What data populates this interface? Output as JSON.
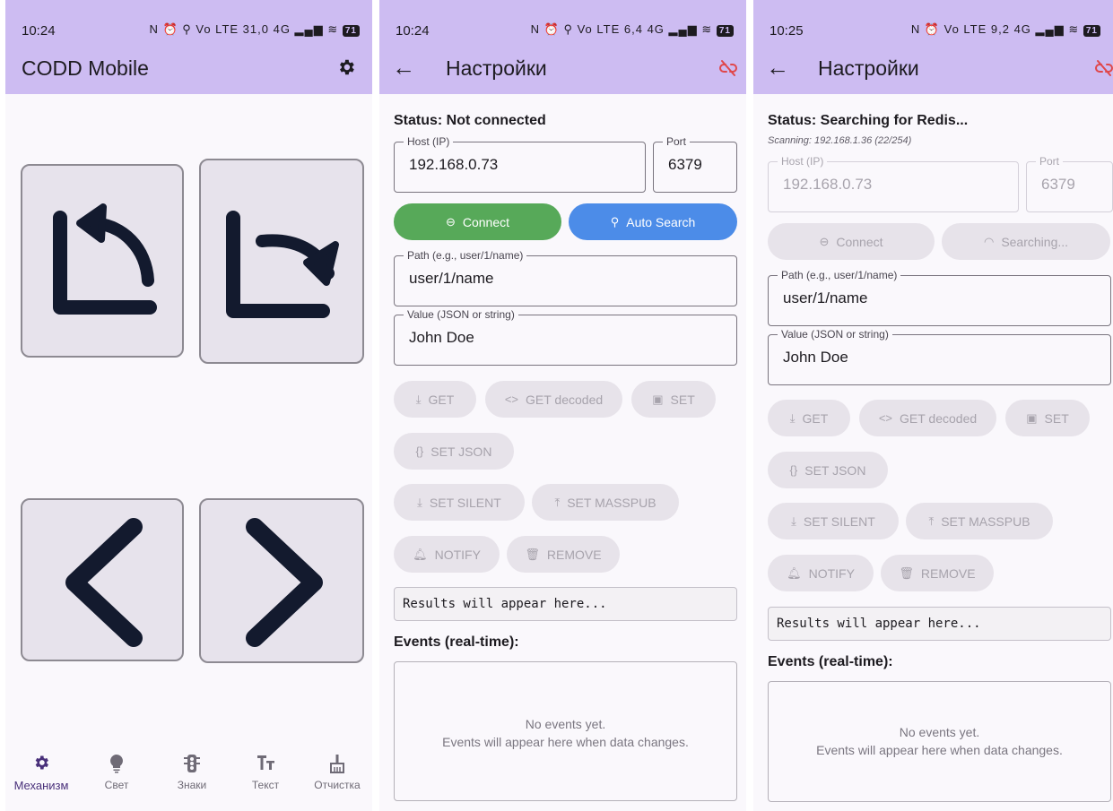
{
  "colors": {
    "appbar": "#cdbcf2",
    "connect_green": "#57a959",
    "search_blue": "#4c8ce8",
    "disconnected_red": "#e0474a",
    "button_icon_navy": "#131a2e"
  },
  "screen1": {
    "status_time": "10:24",
    "status_icons": "N ⏰ ⚲ Vo LTE 31,0 4G ▂▄▆ ≋",
    "battery": "71",
    "title": "CODD Mobile",
    "settings_icon": "gear-icon",
    "buttons": [
      "rotate-left-icon",
      "rotate-right-icon",
      "chevron-left-icon",
      "chevron-right-icon"
    ],
    "nav": [
      {
        "label": "Механизм",
        "icon": "gear-icon"
      },
      {
        "label": "Свет",
        "icon": "lightbulb-icon"
      },
      {
        "label": "Знаки",
        "icon": "traffic-light-icon"
      },
      {
        "label": "Текст",
        "icon": "text-size-icon"
      },
      {
        "label": "Отчистка",
        "icon": "broom-icon"
      }
    ]
  },
  "screen2": {
    "status_time": "10:24",
    "status_icons": "N ⏰ ⚲ Vo LTE 6,4 4G ▂▄▆ ≋",
    "battery": "71",
    "title": "Настройки",
    "status": "Status: Not connected",
    "host_label": "Host (IP)",
    "host_value": "192.168.0.73",
    "port_label": "Port",
    "port_value": "6379",
    "connect_label": "Connect",
    "search_label": "Auto Search",
    "path_label": "Path (e.g., user/1/name)",
    "path_value": "user/1/name",
    "value_label": "Value (JSON or string)",
    "value_value": "John Doe",
    "actions": {
      "get": "GET",
      "get_decoded": "GET decoded",
      "set": "SET",
      "set_json": "SET JSON",
      "set_silent": "SET SILENT",
      "set_masspub": "SET MASSPUB",
      "notify": "NOTIFY",
      "remove": "REMOVE"
    },
    "results": "Results will appear here...",
    "events_title": "Events (real-time):",
    "events_empty_1": "No events yet.",
    "events_empty_2": "Events will appear here when data changes."
  },
  "screen3": {
    "status_time": "10:25",
    "status_icons": "N ⏰ Vo LTE 9,2 4G ▂▄▆ ≋",
    "battery": "71",
    "title": "Настройки",
    "status": "Status: Searching for Redis...",
    "scanning": "Scanning: 192.168.1.36 (22/254)",
    "host_label": "Host (IP)",
    "host_value": "192.168.0.73",
    "port_label": "Port",
    "port_value": "6379",
    "connect_label": "Connect",
    "search_label": "Searching...",
    "path_label": "Path (e.g., user/1/name)",
    "path_value": "user/1/name",
    "value_label": "Value (JSON or string)",
    "value_value": "John Doe",
    "actions": {
      "get": "GET",
      "get_decoded": "GET decoded",
      "set": "SET",
      "set_json": "SET JSON",
      "set_silent": "SET SILENT",
      "set_masspub": "SET MASSPUB",
      "notify": "NOTIFY",
      "remove": "REMOVE"
    },
    "results": "Results will appear here...",
    "events_title": "Events (real-time):",
    "events_empty_1": "No events yet.",
    "events_empty_2": "Events will appear here when data changes."
  }
}
